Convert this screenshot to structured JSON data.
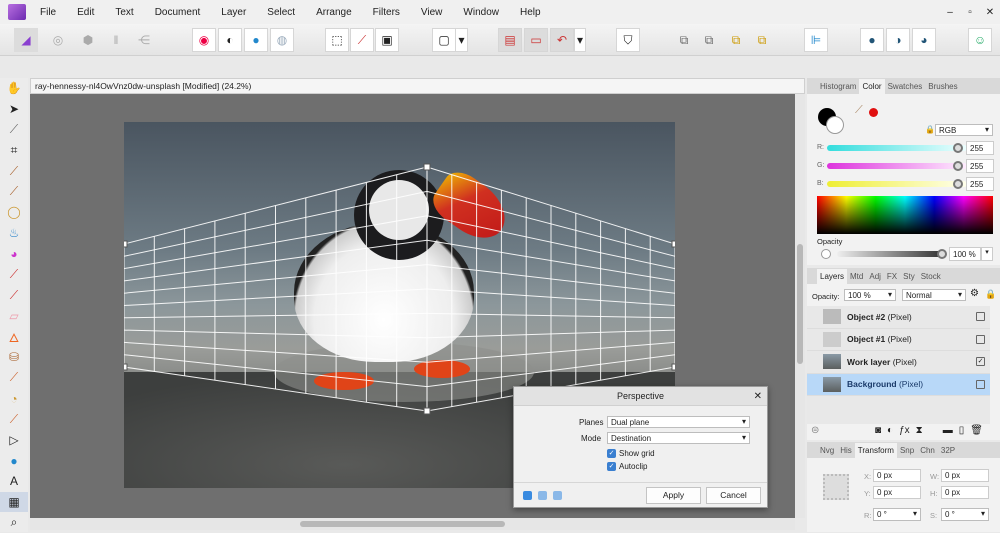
{
  "menu": [
    "File",
    "Edit",
    "Text",
    "Document",
    "Layer",
    "Select",
    "Arrange",
    "Filters",
    "View",
    "Window",
    "Help"
  ],
  "window_controls": [
    "–",
    "▫",
    "✕"
  ],
  "document": {
    "tab_title": "ray-hennessy-nl4OwVnz0dw-unsplash [Modified] (24.2%)"
  },
  "perspective_dialog": {
    "title": "Perspective",
    "planes_label": "Planes",
    "planes_value": "Dual plane",
    "mode_label": "Mode",
    "mode_value": "Destination",
    "show_grid_label": "Show grid",
    "show_grid": true,
    "autoclip_label": "Autoclip",
    "autoclip": true,
    "apply": "Apply",
    "cancel": "Cancel",
    "close": "✕"
  },
  "color_panel": {
    "tabs": [
      "Histogram",
      "Color",
      "Swatches",
      "Brushes"
    ],
    "active_tab": "Color",
    "model": "RGB",
    "r_label": "R:",
    "g_label": "G:",
    "b_label": "B:",
    "r": "255",
    "g": "255",
    "b": "255",
    "opacity_label": "Opacity",
    "opacity": "100 %",
    "accent": "#e01010"
  },
  "layers_panel": {
    "tabs": [
      "Layers",
      "Mtd",
      "Adj",
      "FX",
      "Sty",
      "Stock"
    ],
    "opacity_label": "Opacity:",
    "opacity": "100 %",
    "blend": "Normal",
    "layers": [
      {
        "name": "Object #2",
        "type": "(Pixel)",
        "checked": false
      },
      {
        "name": "Object #1",
        "type": "(Pixel)",
        "checked": false
      },
      {
        "name": "Work layer",
        "type": "(Pixel)",
        "checked": true
      },
      {
        "name": "Background",
        "type": "(Pixel)",
        "checked": false,
        "selected": true
      }
    ]
  },
  "transform_panel": {
    "tabs": [
      "Nvg",
      "His",
      "Transform",
      "Snp",
      "Chn",
      "32P"
    ],
    "x_label": "X:",
    "x": "0 px",
    "y_label": "Y:",
    "y": "0 px",
    "w_label": "W:",
    "w": "0 px",
    "h_label": "H:",
    "h": "0 px",
    "r_label": "R:",
    "r": "0 °",
    "s_label": "S:",
    "s": "0 °"
  }
}
